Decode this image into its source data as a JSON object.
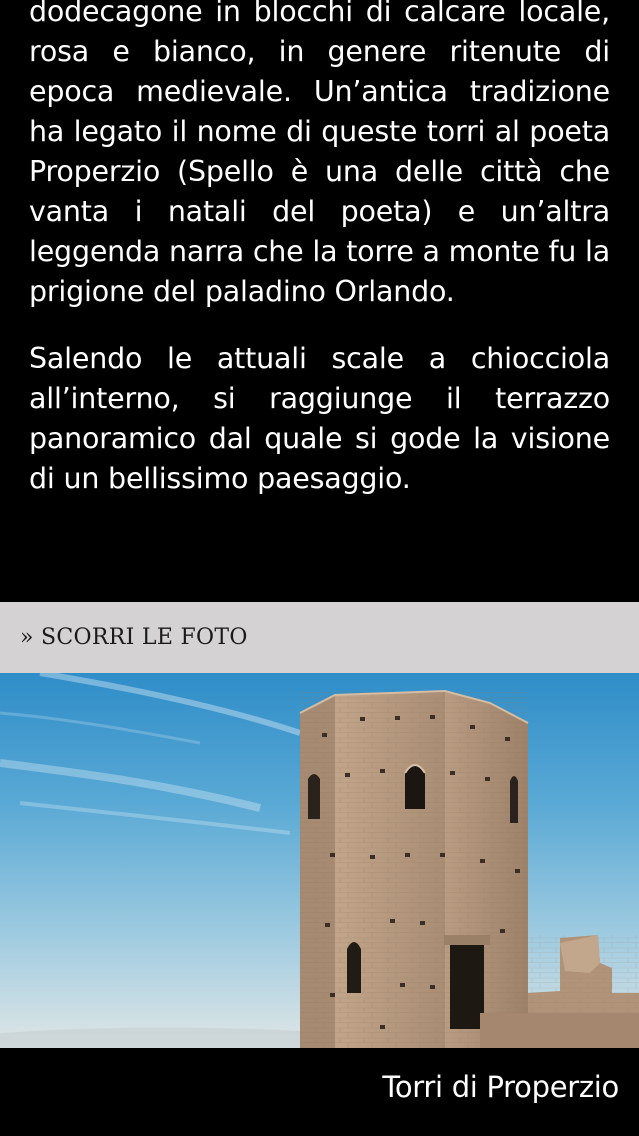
{
  "article": {
    "paragraphs": [
      "dodecagone in blocchi di calcare locale, rosa e bianco, in genere ritenute di epoca medievale. Un’antica tradizione ha legato il nome di queste torri al poeta Properzio (Spello è una delle città che vanta i natali del poeta) e un’altra leggenda narra che la torre a monte fu la prigione del paladino Orlando.",
      "Salendo le attuali scale a chiocciola all’interno, si raggiunge il terrazzo panoramico dal quale si gode la visione di un bellissimo paesaggio."
    ]
  },
  "gallery": {
    "label": "» SCORRI LE FOTO"
  },
  "photo": {
    "subject": "medieval-stone-tower"
  },
  "caption": {
    "text": "Torri di Properzio"
  },
  "colors": {
    "background": "#000000",
    "text": "#ffffff",
    "gallery_bar": "#d4d2d3",
    "gallery_text": "#1a1a1a",
    "sky_top": "#2f8fc9",
    "stone": "#b79a80"
  }
}
